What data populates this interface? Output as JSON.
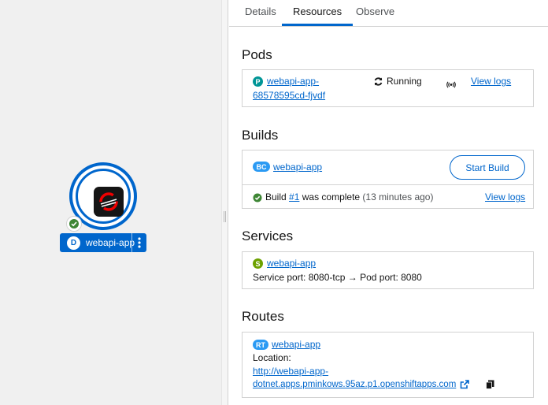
{
  "node": {
    "kind_badge": "D",
    "name": "webapi-app"
  },
  "tabs": [
    "Details",
    "Resources",
    "Observe"
  ],
  "pods": {
    "heading": "Pods",
    "badge": "P",
    "name_line1": "webapi-app-",
    "name_line2": "68578595cd-fjvdf",
    "status": "Running",
    "view_logs": "View logs"
  },
  "builds": {
    "heading": "Builds",
    "badge": "BC",
    "name": "webapi-app",
    "start_build": "Start Build",
    "status_prefix": "Build ",
    "build_number": "#1",
    "status_suffix": " was complete",
    "status_time": " (13 minutes ago)",
    "view_logs": "View logs"
  },
  "services": {
    "heading": "Services",
    "badge": "S",
    "name": "webapi-app",
    "port_label": "Service port: ",
    "service_port": "8080-tcp",
    "arrow": "→",
    "pod_port_label": " Pod port: ",
    "pod_port": "8080"
  },
  "routes": {
    "heading": "Routes",
    "badge": "RT",
    "name": "webapi-app",
    "location_label": "Location:",
    "url_line1": "http://webapi-app-",
    "url_line2": "dotnet.apps.pminkows.95az.p1.openshiftapps.com"
  },
  "colors": {
    "accent": "#0066cc",
    "success": "#3e8635",
    "pod_badge": "#009596",
    "service_badge": "#6ca100",
    "build_badge": "#2b9af3",
    "route_badge": "#2b9af3"
  }
}
